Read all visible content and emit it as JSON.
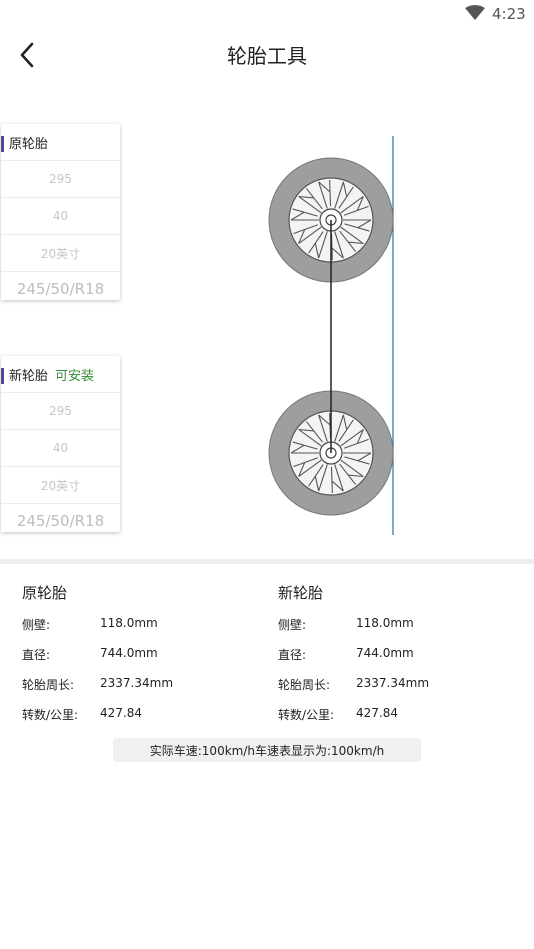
{
  "status_bar": {
    "time": "4:23"
  },
  "header": {
    "title": "轮胎工具"
  },
  "original_tire": {
    "title": "原轮胎",
    "width": "295",
    "aspect_ratio": "40",
    "rim": "20英寸",
    "spec": "245/50/R18"
  },
  "new_tire": {
    "title": "新轮胎",
    "status": "可安装",
    "status_color": "#2f8f2f",
    "width": "295",
    "aspect_ratio": "40",
    "rim": "20英寸",
    "spec": "245/50/R18"
  },
  "specs": {
    "original": {
      "title": "原轮胎",
      "rows": [
        {
          "label": "侧壁:",
          "value": "118.0mm"
        },
        {
          "label": "直径:",
          "value": "744.0mm"
        },
        {
          "label": "轮胎周长:",
          "value": "2337.34mm"
        },
        {
          "label": "转数/公里:",
          "value": "427.84"
        }
      ]
    },
    "new": {
      "title": "新轮胎",
      "rows": [
        {
          "label": "侧壁:",
          "value": "118.0mm"
        },
        {
          "label": "直径:",
          "value": "744.0mm"
        },
        {
          "label": "轮胎周长:",
          "value": "2337.34mm"
        },
        {
          "label": "转数/公里:",
          "value": "427.84"
        }
      ]
    }
  },
  "speed_note": "实际车速:100km/h车速表显示为:100km/h",
  "colors": {
    "accent_mark": "#5b3fa8",
    "reference_line": "#1f77b4",
    "tire": "#9e9e9e"
  }
}
